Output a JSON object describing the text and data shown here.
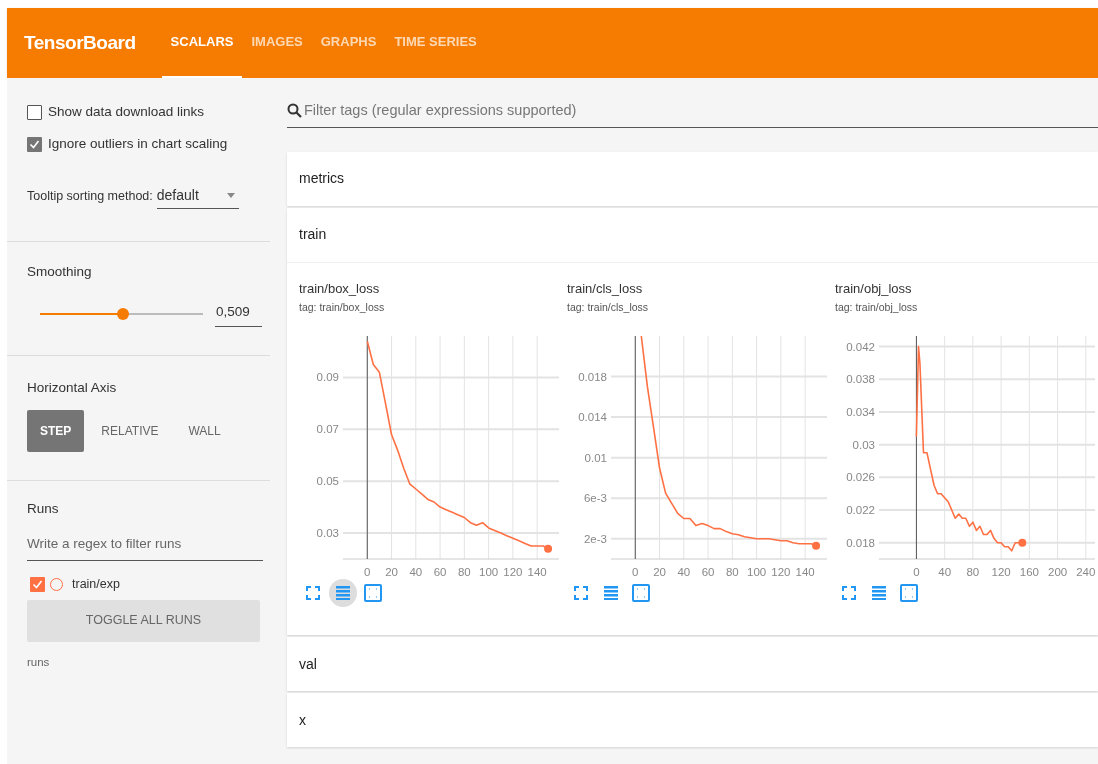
{
  "header": {
    "brand": "TensorBoard",
    "tabs": [
      {
        "label": "SCALARS",
        "selected": true
      },
      {
        "label": "IMAGES",
        "selected": false
      },
      {
        "label": "GRAPHS",
        "selected": false
      },
      {
        "label": "TIME SERIES",
        "selected": false
      }
    ]
  },
  "sidebar": {
    "options": [
      {
        "label": "Show data download links",
        "checked": false
      },
      {
        "label": "Ignore outliers in chart scaling",
        "checked": true
      }
    ],
    "tooltip_sorting": {
      "label": "Tooltip sorting method:",
      "value": "default"
    },
    "smoothing": {
      "title": "Smoothing",
      "level": 0.509,
      "reading": "0,509"
    },
    "horizontal_axis": {
      "title": "Horizontal Axis",
      "options": [
        {
          "label": "STEP",
          "selected": true
        },
        {
          "label": "RELATIVE",
          "selected": false
        },
        {
          "label": "WALL",
          "selected": false
        }
      ]
    },
    "runs": {
      "title": "Runs",
      "placeholder": "Write a regex to filter runs",
      "items": [
        {
          "label": "train/exp",
          "checked": true,
          "color": "#ff7043"
        }
      ],
      "toggle_button": "TOGGLE ALL RUNS",
      "footer": "runs"
    }
  },
  "main": {
    "search_placeholder": "Filter tags (regular expressions supported)",
    "sections": [
      {
        "title": "metrics"
      },
      {
        "title": "train",
        "charts": [
          {
            "title": "train/box_loss",
            "tag": "tag: train/box_loss",
            "toggle_highlighted": true,
            "chart_data": {
              "type": "line",
              "grid": true,
              "xlim": [
                -20,
                158
              ],
              "ylim": [
                0.02,
                0.106
              ],
              "xticks": [
                0,
                20,
                40,
                60,
                80,
                100,
                120,
                140
              ],
              "yticks": [
                0.03,
                0.05,
                0.07,
                0.09
              ],
              "x": [
                0,
                5,
                10,
                15,
                20,
                25,
                30,
                35,
                40,
                45,
                50,
                55,
                60,
                65,
                70,
                75,
                80,
                85,
                90,
                95,
                100,
                105,
                110,
                115,
                120,
                125,
                130,
                135,
                140,
                145,
                149
              ],
              "series": [
                {
                  "color": "#ff7043",
                  "values": [
                    0.104,
                    0.095,
                    0.092,
                    0.08,
                    0.068,
                    0.062,
                    0.055,
                    0.049,
                    0.047,
                    0.045,
                    0.043,
                    0.042,
                    0.04,
                    0.039,
                    0.038,
                    0.037,
                    0.036,
                    0.034,
                    0.033,
                    0.034,
                    0.032,
                    0.031,
                    0.03,
                    0.029,
                    0.028,
                    0.027,
                    0.026,
                    0.025,
                    0.025,
                    0.025,
                    0.024
                  ]
                }
              ]
            }
          },
          {
            "title": "train/cls_loss",
            "tag": "tag: train/cls_loss",
            "toggle_highlighted": false,
            "chart_data": {
              "type": "line",
              "grid": true,
              "xlim": [
                -20,
                158
              ],
              "ylim": [
                0,
                0.022
              ],
              "xticks": [
                0,
                20,
                40,
                60,
                80,
                100,
                120,
                140
              ],
              "yticks": [
                {
                  "value": 0.002,
                  "label": "2e-3"
                },
                {
                  "value": 0.006,
                  "label": "6e-3"
                },
                {
                  "value": 0.01,
                  "label": "0.01"
                },
                {
                  "value": 0.014,
                  "label": "0.014"
                },
                {
                  "value": 0.018,
                  "label": "0.018"
                }
              ],
              "x": [
                5,
                10,
                15,
                20,
                25,
                30,
                35,
                40,
                45,
                50,
                55,
                60,
                65,
                70,
                75,
                80,
                85,
                90,
                95,
                100,
                105,
                110,
                115,
                120,
                125,
                130,
                135,
                140,
                145,
                149
              ],
              "series": [
                {
                  "color": "#ff7043",
                  "values": [
                    0.022,
                    0.017,
                    0.013,
                    0.009,
                    0.0065,
                    0.0055,
                    0.0045,
                    0.004,
                    0.004,
                    0.0033,
                    0.0035,
                    0.0033,
                    0.003,
                    0.003,
                    0.0027,
                    0.0025,
                    0.0024,
                    0.0022,
                    0.0021,
                    0.002,
                    0.002,
                    0.002,
                    0.0019,
                    0.0018,
                    0.0018,
                    0.0016,
                    0.0015,
                    0.0015,
                    0.0015,
                    0.0013
                  ]
                }
              ]
            }
          },
          {
            "title": "train/obj_loss",
            "tag": "tag: train/obj_loss",
            "toggle_highlighted": false,
            "chart_data": {
              "type": "line",
              "grid": true,
              "xlim": [
                -53,
                253
              ],
              "ylim": [
                0.016,
                0.0433
              ],
              "xticks": [
                0,
                40,
                80,
                120,
                160,
                200,
                240
              ],
              "yticks": [
                0.018,
                0.022,
                0.026,
                0.03,
                0.034,
                0.038,
                0.042
              ],
              "x": [
                0,
                3,
                5,
                10,
                15,
                20,
                25,
                30,
                35,
                40,
                45,
                50,
                55,
                60,
                65,
                70,
                75,
                80,
                85,
                90,
                95,
                100,
                105,
                110,
                115,
                120,
                125,
                130,
                135,
                140,
                145,
                150
              ],
              "series": [
                {
                  "color": "#ff7043",
                  "values": [
                    0.031,
                    0.042,
                    0.04,
                    0.029,
                    0.029,
                    0.027,
                    0.025,
                    0.024,
                    0.024,
                    0.0235,
                    0.023,
                    0.022,
                    0.021,
                    0.0215,
                    0.021,
                    0.021,
                    0.02,
                    0.0205,
                    0.0195,
                    0.02,
                    0.019,
                    0.019,
                    0.0195,
                    0.0185,
                    0.018,
                    0.018,
                    0.0175,
                    0.0175,
                    0.017,
                    0.018,
                    0.018,
                    0.018
                  ]
                }
              ]
            }
          }
        ]
      },
      {
        "title": "val"
      },
      {
        "title": "x"
      }
    ]
  }
}
